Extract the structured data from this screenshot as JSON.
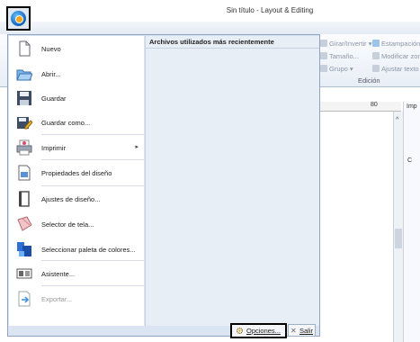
{
  "window": {
    "title": "Sin título - Layout & Editing"
  },
  "ribbon": {
    "items": [
      {
        "label": "Girar/Invertir ▾",
        "icon": "rotate-icon"
      },
      {
        "label": "Estampación",
        "icon": "stamp-icon"
      },
      {
        "label": "Tamaño...",
        "icon": "size-icon"
      },
      {
        "label": "Modificar zona",
        "icon": "modify-zone-icon"
      },
      {
        "label": "Grupo ▾",
        "icon": "group-icon"
      },
      {
        "label": "Ajustar texto",
        "icon": "fit-text-icon"
      }
    ],
    "group_label": "Edición"
  },
  "ruler": {
    "mark": "80"
  },
  "right_panel": {
    "labels": [
      "Imp",
      "C"
    ]
  },
  "app_menu": {
    "recent_header": "Archivos utilizados más recientemente",
    "items": [
      {
        "label": "Nuevo",
        "icon": "new-file-icon",
        "enabled": true
      },
      {
        "label": "Abrir...",
        "icon": "open-folder-icon",
        "enabled": true
      },
      {
        "label": "Guardar",
        "icon": "save-icon",
        "enabled": true
      },
      {
        "label": "Guardar como...",
        "icon": "save-as-icon",
        "enabled": true
      },
      {
        "label": "Imprimir",
        "icon": "print-icon",
        "enabled": true,
        "submenu": true
      },
      {
        "label": "Propiedades del diseño",
        "icon": "design-properties-icon",
        "enabled": true
      },
      {
        "label": "Ajustes de diseño...",
        "icon": "design-settings-icon",
        "enabled": true
      },
      {
        "label": "Selector de tela...",
        "icon": "fabric-selector-icon",
        "enabled": true
      },
      {
        "label": "Seleccionar paleta de colores...",
        "icon": "color-palette-icon",
        "enabled": true
      },
      {
        "label": "Asistente...",
        "icon": "wizard-icon",
        "enabled": true
      },
      {
        "label": "Exportar...",
        "icon": "export-icon",
        "enabled": false
      }
    ],
    "options_label": "Opciones...",
    "exit_label": "Salir"
  }
}
